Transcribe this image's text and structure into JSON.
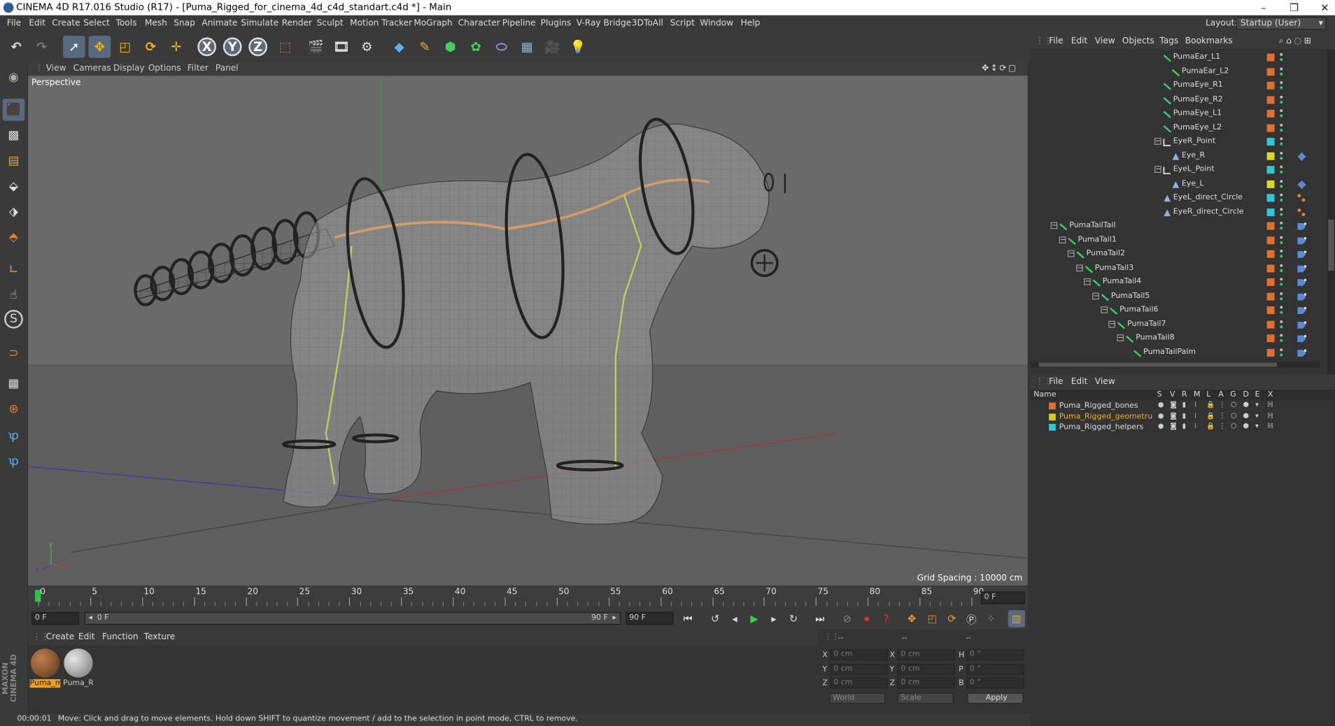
{
  "window": {
    "title": "CINEMA 4D R17.016 Studio (R17) - [Puma_Rigged_for_cinema_4d_c4d_standart.c4d *] - Main",
    "min": "–",
    "restore": "❐",
    "close": "✕"
  },
  "menu": [
    "File",
    "Edit",
    "Create",
    "Select",
    "Tools",
    "Mesh",
    "Snap",
    "Animate",
    "Simulate",
    "Render",
    "Sculpt",
    "Motion Tracker",
    "MoGraph",
    "Character",
    "Pipeline",
    "Plugins",
    "V-Ray Bridge",
    "3DToAll",
    "Script",
    "Window",
    "Help"
  ],
  "layout": {
    "label": "Layout:",
    "value": "Startup (User)"
  },
  "viewport": {
    "menu": [
      "View",
      "Cameras",
      "Display",
      "Options",
      "Filter",
      "Panel"
    ],
    "label": "Perspective",
    "grid_spacing": "Grid Spacing : 10000 cm"
  },
  "timeline": {
    "ticks": [
      "0",
      "5",
      "10",
      "15",
      "20",
      "25",
      "30",
      "35",
      "40",
      "45",
      "50",
      "55",
      "60",
      "65",
      "70",
      "75",
      "80",
      "85",
      "90"
    ],
    "current": "0 F"
  },
  "transport": {
    "start": "0 F",
    "slider_start": "0 F",
    "slider_end": "90 F",
    "end": "90 F"
  },
  "materials": {
    "menu": [
      "Create",
      "Edit",
      "Function",
      "Texture"
    ],
    "items": [
      {
        "name": "Puma_m",
        "color": "#8a5a34"
      },
      {
        "name": "Puma_R",
        "color": "#9a9a9a"
      }
    ]
  },
  "coords": {
    "header": [
      "--",
      "--",
      "--"
    ],
    "rows": [
      {
        "a": "X",
        "av": "0 cm",
        "b": "X",
        "bv": "0 cm",
        "c": "H",
        "cv": "0 °"
      },
      {
        "a": "Y",
        "av": "0 cm",
        "b": "Y",
        "bv": "0 cm",
        "c": "P",
        "cv": "0 °"
      },
      {
        "a": "Z",
        "av": "0 cm",
        "b": "Z",
        "bv": "0 cm",
        "c": "B",
        "cv": "0 °"
      }
    ],
    "world": "World",
    "scale": "Scale",
    "apply": "Apply"
  },
  "status": {
    "time": "00:00:01",
    "text": "Move: Click and drag to move elements. Hold down SHIFT to quantize movement / add to the selection in point mode, CTRL to remove."
  },
  "objects": {
    "menu": [
      "File",
      "Edit",
      "View",
      "Objects",
      "Tags",
      "Bookmarks"
    ],
    "rows": [
      {
        "name": "PumaEar_L1",
        "indent": 1378,
        "color": "#e07030",
        "type": "bone"
      },
      {
        "name": "PumaEar_L2",
        "indent": 1388,
        "color": "#e07030",
        "type": "bone"
      },
      {
        "name": "PumaEye_R1",
        "indent": 1378,
        "color": "#e07030",
        "type": "bone"
      },
      {
        "name": "PumaEye_R2",
        "indent": 1378,
        "color": "#e07030",
        "type": "bone"
      },
      {
        "name": "PumaEye_L1",
        "indent": 1378,
        "color": "#e07030",
        "type": "bone"
      },
      {
        "name": "PumaEye_L2",
        "indent": 1378,
        "color": "#e07030",
        "type": "bone"
      },
      {
        "name": "EyeR_Point",
        "indent": 1378,
        "color": "#30c8d8",
        "type": "null"
      },
      {
        "name": "Eye_R",
        "indent": 1388,
        "color": "#d8d830",
        "type": "point"
      },
      {
        "name": "EyeL_Point",
        "indent": 1378,
        "color": "#30c8d8",
        "type": "null"
      },
      {
        "name": "Eye_L",
        "indent": 1388,
        "color": "#d8d830",
        "type": "point"
      },
      {
        "name": "EyeL_direct_Circle",
        "indent": 1378,
        "color": "#30c8d8",
        "type": "point"
      },
      {
        "name": "EyeR_direct_Circle",
        "indent": 1378,
        "color": "#30c8d8",
        "type": "point"
      },
      {
        "name": "PumaTailTail",
        "indent": 1256,
        "color": "#e07030",
        "type": "bone"
      },
      {
        "name": "PumaTail1",
        "indent": 1266,
        "color": "#e07030",
        "type": "bone"
      },
      {
        "name": "PumaTail2",
        "indent": 1276,
        "color": "#e07030",
        "type": "bone"
      },
      {
        "name": "PumaTail3",
        "indent": 1286,
        "color": "#e07030",
        "type": "bone"
      },
      {
        "name": "PumaTail4",
        "indent": 1295,
        "color": "#e07030",
        "type": "bone"
      },
      {
        "name": "PumaTail5",
        "indent": 1305,
        "color": "#e07030",
        "type": "bone"
      },
      {
        "name": "PumaTail6",
        "indent": 1315,
        "color": "#e07030",
        "type": "bone"
      },
      {
        "name": "PumaTail7",
        "indent": 1324,
        "color": "#e07030",
        "type": "bone"
      },
      {
        "name": "PumaTail8",
        "indent": 1334,
        "color": "#e07030",
        "type": "bone"
      },
      {
        "name": "PumaTailPalm",
        "indent": 1343,
        "color": "#e07030",
        "type": "bone"
      }
    ]
  },
  "layers": {
    "menu": [
      "File",
      "Edit",
      "View"
    ],
    "columns": [
      "Name",
      "S",
      "V",
      "R",
      "M",
      "L",
      "A",
      "G",
      "D",
      "E",
      "X"
    ],
    "rows": [
      {
        "name": "Puma_Rigged_bones",
        "color": "#e07030",
        "text": "#ddd"
      },
      {
        "name": "Puma_Rigged_geometru",
        "color": "#d8c820",
        "text": "#ffb000"
      },
      {
        "name": "Puma_Rigged_helpers",
        "color": "#30c8d8",
        "text": "#ddd"
      }
    ]
  },
  "side_logo": "MAXON CINEMA 4D"
}
